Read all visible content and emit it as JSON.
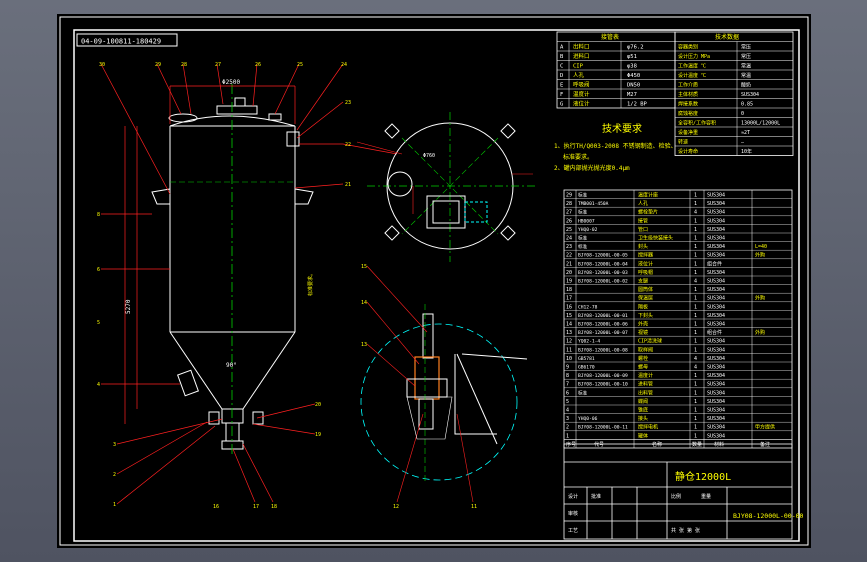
{
  "drawing_code_tag": "04-09-100811-180429",
  "title_block": {
    "product": "静仓12000L",
    "drawing_no": "BJY08-12000L-00-00",
    "note_1": "1、执行TH/Q003-2008 不锈钢制造、检验、",
    "note_1b": "标准要求。",
    "note_2": "2、罐内部抛光抛光度0.4μm",
    "tech_heading": "技术要求"
  },
  "spec_table": {
    "header_left": "接管表",
    "header_right": "技术数据",
    "rows_left": [
      {
        "id": "A",
        "name": "出料口",
        "spec": "φ76.2"
      },
      {
        "id": "B",
        "name": "进料口",
        "spec": "φ51"
      },
      {
        "id": "C",
        "name": "CIP",
        "spec": "φ38"
      },
      {
        "id": "D",
        "name": "人孔",
        "spec": "Φ450"
      },
      {
        "id": "E",
        "name": "呼吸阀",
        "spec": "DN50"
      },
      {
        "id": "F",
        "name": "温度计",
        "spec": "M27"
      },
      {
        "id": "G",
        "name": "液位计",
        "spec": "1/2 BP"
      }
    ],
    "rows_right": [
      {
        "k": "容器类别",
        "v": "常压"
      },
      {
        "k": "设计压力 MPa",
        "v": "常压"
      },
      {
        "k": "工作温度 ℃",
        "v": "常温"
      },
      {
        "k": "设计温度 ℃",
        "v": "常温"
      },
      {
        "k": "工作介质",
        "v": "酸奶"
      },
      {
        "k": "主体材质",
        "v": "SUS304"
      },
      {
        "k": "焊接系数",
        "v": "0.85"
      },
      {
        "k": "腐蚀裕度",
        "v": "0"
      },
      {
        "k": "全容积/工作容积",
        "v": "13000L/12000L"
      },
      {
        "k": "设备净重",
        "v": "≈2T"
      },
      {
        "k": "转速",
        "v": "—"
      },
      {
        "k": "设计寿命",
        "v": "10年"
      }
    ]
  },
  "bom": {
    "columns": [
      "序号",
      "代号",
      "名称",
      "数量",
      "材料",
      "备注"
    ],
    "rows": [
      {
        "no": "29",
        "code": "标准",
        "name": "温度计座",
        "qty": "1",
        "mat": "SUS304",
        "note": ""
      },
      {
        "no": "28",
        "code": "TMB001-450A",
        "name": "人孔",
        "qty": "1",
        "mat": "SUS304",
        "note": ""
      },
      {
        "no": "27",
        "code": "标准",
        "name": "螺栓垫片",
        "qty": "4",
        "mat": "SUS304",
        "note": ""
      },
      {
        "no": "26",
        "code": "HB0007",
        "name": "接管",
        "qty": "1",
        "mat": "SUS304",
        "note": ""
      },
      {
        "no": "25",
        "code": "YHQ0-02",
        "name": "管口",
        "qty": "1",
        "mat": "SUS304",
        "note": ""
      },
      {
        "no": "24",
        "code": "标准",
        "name": "卫生级快装接头",
        "qty": "1",
        "mat": "SUS304",
        "note": ""
      },
      {
        "no": "23",
        "code": "标准",
        "name": "封头",
        "qty": "1",
        "mat": "SUS304",
        "note": "L=40"
      },
      {
        "no": "22",
        "code": "BJY08-12000L-00-05",
        "name": "搅拌器",
        "qty": "1",
        "mat": "SUS304",
        "note": "外购"
      },
      {
        "no": "21",
        "code": "BJY08-12000L-00-04",
        "name": "液位计",
        "qty": "1",
        "mat": "组合件",
        "note": ""
      },
      {
        "no": "20",
        "code": "BJY08-12000L-00-03",
        "name": "呼吸帽",
        "qty": "1",
        "mat": "SUS304",
        "note": ""
      },
      {
        "no": "19",
        "code": "BJY08-12000L-00-02",
        "name": "支腿",
        "qty": "4",
        "mat": "SUS304",
        "note": ""
      },
      {
        "no": "18",
        "code": "",
        "name": "圆筒体",
        "qty": "1",
        "mat": "SUS304",
        "note": ""
      },
      {
        "no": "17",
        "code": "",
        "name": "保温层",
        "qty": "1",
        "mat": "SUS304",
        "note": "外购"
      },
      {
        "no": "16",
        "code": "CH12-78",
        "name": "隔板",
        "qty": "1",
        "mat": "SUS304",
        "note": ""
      },
      {
        "no": "15",
        "code": "BJY08-12000L-00-01",
        "name": "下封头",
        "qty": "1",
        "mat": "SUS304",
        "note": ""
      },
      {
        "no": "14",
        "code": "BJY08-12000L-00-06",
        "name": "外壳",
        "qty": "1",
        "mat": "SUS304",
        "note": ""
      },
      {
        "no": "13",
        "code": "BJY08-12000L-00-07",
        "name": "视镜",
        "qty": "1",
        "mat": "组合件",
        "note": "外购"
      },
      {
        "no": "12",
        "code": "YQ02-1-4",
        "name": "CIP清洗球",
        "qty": "1",
        "mat": "SUS304",
        "note": ""
      },
      {
        "no": "11",
        "code": "BJY08-12000L-00-08",
        "name": "取样阀",
        "qty": "1",
        "mat": "SUS304",
        "note": ""
      },
      {
        "no": "10",
        "code": "GB5781",
        "name": "螺栓",
        "qty": "4",
        "mat": "SUS304",
        "note": ""
      },
      {
        "no": "9",
        "code": "GB6170",
        "name": "螺母",
        "qty": "4",
        "mat": "SUS304",
        "note": ""
      },
      {
        "no": "8",
        "code": "BJY08-12000L-00-09",
        "name": "温度计",
        "qty": "1",
        "mat": "SUS304",
        "note": ""
      },
      {
        "no": "7",
        "code": "BJY08-12000L-00-10",
        "name": "进料管",
        "qty": "1",
        "mat": "SUS304",
        "note": ""
      },
      {
        "no": "6",
        "code": "标准",
        "name": "出料管",
        "qty": "1",
        "mat": "SUS304",
        "note": ""
      },
      {
        "no": "5",
        "code": "",
        "name": "蝶阀",
        "qty": "1",
        "mat": "SUS304",
        "note": ""
      },
      {
        "no": "4",
        "code": "",
        "name": "锥底",
        "qty": "1",
        "mat": "SUS304",
        "note": ""
      },
      {
        "no": "3",
        "code": "YHQ0-06",
        "name": "接头",
        "qty": "1",
        "mat": "SUS304",
        "note": ""
      },
      {
        "no": "2",
        "code": "BJY08-12000L-00-11",
        "name": "搅拌电机",
        "qty": "1",
        "mat": "SUS304",
        "note": "甲方提供"
      },
      {
        "no": "1",
        "code": "",
        "name": "罐体",
        "qty": "1",
        "mat": "SUS304",
        "note": ""
      }
    ]
  },
  "sign_block": {
    "design": "设计",
    "check": "审核",
    "approve": "批准",
    "process": "工艺",
    "scale": "比例",
    "weight": "重量",
    "sheet": "共 张 第 张"
  },
  "dims": {
    "height": "5270",
    "dia": "Φ2500",
    "cone": "90°",
    "r1": "Φ760",
    "mark_50": "50"
  },
  "colors": {
    "line": "#ffffff",
    "center": "#00d000",
    "dim": "#ff2020",
    "tag": "#ffff00",
    "hatch": "#00ffff",
    "frame": "#ffffff"
  }
}
